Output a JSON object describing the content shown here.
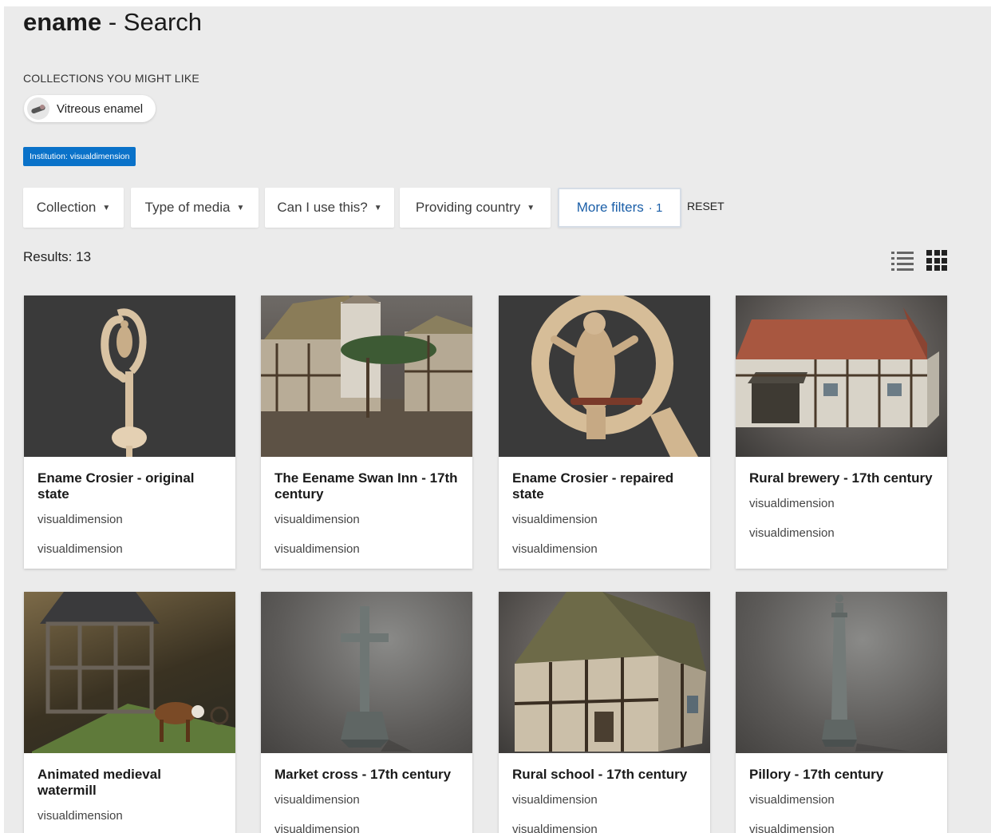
{
  "page": {
    "title_bold": "ename",
    "title_rest": " - Search"
  },
  "collections": {
    "label": "COLLECTIONS YOU MIGHT LIKE",
    "items": [
      {
        "label": "Vitreous enamel"
      }
    ]
  },
  "active_tag": "Institution: visualdimension",
  "filters": {
    "items": [
      {
        "label": "Collection"
      },
      {
        "label": "Type of media"
      },
      {
        "label": "Can I use this?"
      },
      {
        "label": "Providing country"
      }
    ],
    "more": {
      "label": "More filters",
      "count": "· 1"
    },
    "reset": "RESET"
  },
  "results": {
    "label": "Results: 13"
  },
  "view": {
    "icons": [
      "list-view-icon",
      "grid-view-icon"
    ],
    "active": "grid"
  },
  "accent_color": "#0a72c9",
  "cards": [
    {
      "title": "Ename Crosier - original state",
      "meta1": "visualdimension",
      "meta2": "visualdimension"
    },
    {
      "title": "The Eename Swan Inn - 17th century",
      "meta1": "visualdimension",
      "meta2": "visualdimension"
    },
    {
      "title": "Ename Crosier - repaired state",
      "meta1": "visualdimension",
      "meta2": "visualdimension"
    },
    {
      "title": "Rural brewery - 17th century",
      "meta1": "visualdimension",
      "meta2": "visualdimension"
    },
    {
      "title": "Animated medieval watermill",
      "meta1": "visualdimension",
      "meta2": ""
    },
    {
      "title": "Market cross - 17th century",
      "meta1": "visualdimension",
      "meta2": "visualdimension"
    },
    {
      "title": "Rural school - 17th century",
      "meta1": "visualdimension",
      "meta2": "visualdimension"
    },
    {
      "title": "Pillory - 17th century",
      "meta1": "visualdimension",
      "meta2": "visualdimension"
    }
  ]
}
